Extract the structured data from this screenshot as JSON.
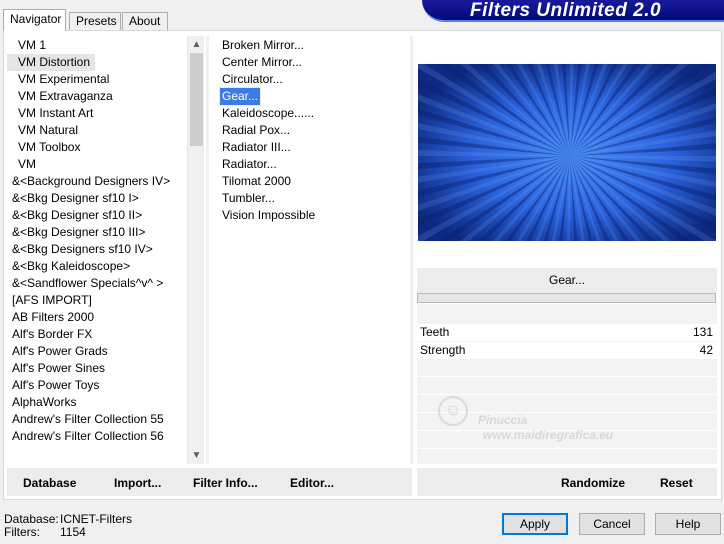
{
  "header": {
    "title": "Filters Unlimited 2.0"
  },
  "tabs": [
    {
      "label": "Navigator",
      "active": true
    },
    {
      "label": "Presets",
      "active": false
    },
    {
      "label": "About",
      "active": false
    }
  ],
  "categories": [
    "VM 1",
    "VM Distortion",
    "VM Experimental",
    "VM Extravaganza",
    "VM Instant Art",
    "VM Natural",
    "VM Toolbox",
    "VM",
    "&<Background Designers IV>",
    "&<Bkg Designer sf10 I>",
    "&<Bkg Designer sf10 II>",
    "&<Bkg Designer sf10 III>",
    "&<Bkg Designers sf10 IV>",
    "&<Bkg Kaleidoscope>",
    "&<Sandflower Specials^v^ >",
    "[AFS IMPORT]",
    "AB Filters 2000",
    "Alf's Border FX",
    "Alf's Power Grads",
    "Alf's Power Sines",
    "Alf's Power Toys",
    "AlphaWorks",
    "Andrew's Filter Collection 55",
    "Andrew's Filter Collection 56"
  ],
  "selected_category": "VM Distortion",
  "filters": [
    "Broken Mirror...",
    "Center Mirror...",
    "Circulator...",
    "Gear...",
    "Kaleidoscope......",
    "Radial Pox...",
    "Radiator III...",
    "Radiator...",
    "Tilomat 2000",
    "Tumbler...",
    "Vision Impossible"
  ],
  "selected_filter": "Gear...",
  "effect": {
    "title": "Gear...",
    "params": [
      {
        "name": "Teeth",
        "value": "131"
      },
      {
        "name": "Strength",
        "value": "42"
      }
    ]
  },
  "watermark": {
    "line1": "Pinuccia",
    "line2": "www.maidiregrafica.eu"
  },
  "toolbar_left": {
    "database": "Database",
    "import": "Import...",
    "filter_info": "Filter Info...",
    "editor": "Editor..."
  },
  "toolbar_right": {
    "randomize": "Randomize",
    "reset": "Reset"
  },
  "status": {
    "database_label": "Database:",
    "database_value": "ICNET-Filters",
    "filters_label": "Filters:",
    "filters_value": "1154"
  },
  "buttons": {
    "apply": "Apply",
    "cancel": "Cancel",
    "help": "Help"
  },
  "colors": {
    "banner": "#00137e",
    "selection": "#3d7ce8",
    "preview": "#1e4fc8"
  }
}
